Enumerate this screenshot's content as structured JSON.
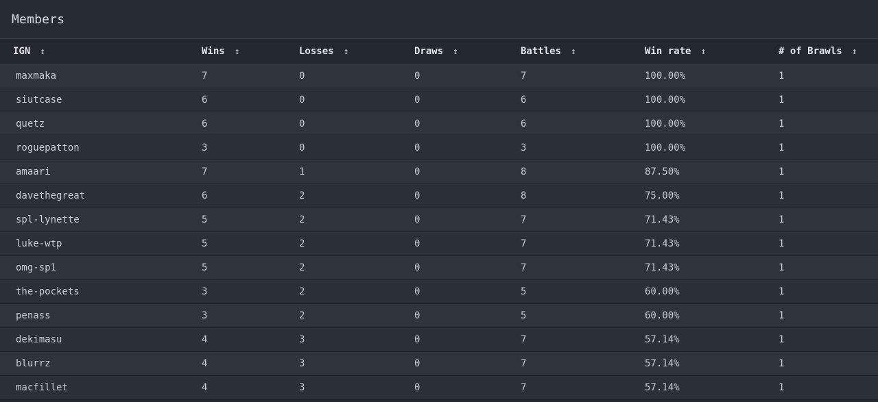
{
  "panel": {
    "title": "Members"
  },
  "table": {
    "columns": [
      {
        "label": "IGN",
        "sort_glyph": "↕"
      },
      {
        "label": "Wins",
        "sort_glyph": "↕"
      },
      {
        "label": "Losses",
        "sort_glyph": "↕"
      },
      {
        "label": "Draws",
        "sort_glyph": "↕"
      },
      {
        "label": "Battles",
        "sort_glyph": "↕"
      },
      {
        "label": "Win rate",
        "sort_glyph": "↕"
      },
      {
        "label": "# of Brawls",
        "sort_glyph": "↕"
      }
    ],
    "rows": [
      [
        "maxmaka",
        "7",
        "0",
        "0",
        "7",
        "100.00%",
        "1"
      ],
      [
        "siutcase",
        "6",
        "0",
        "0",
        "6",
        "100.00%",
        "1"
      ],
      [
        "quetz",
        "6",
        "0",
        "0",
        "6",
        "100.00%",
        "1"
      ],
      [
        "roguepatton",
        "3",
        "0",
        "0",
        "3",
        "100.00%",
        "1"
      ],
      [
        "amaari",
        "7",
        "1",
        "0",
        "8",
        "87.50%",
        "1"
      ],
      [
        "davethegreat",
        "6",
        "2",
        "0",
        "8",
        "75.00%",
        "1"
      ],
      [
        "spl-lynette",
        "5",
        "2",
        "0",
        "7",
        "71.43%",
        "1"
      ],
      [
        "luke-wtp",
        "5",
        "2",
        "0",
        "7",
        "71.43%",
        "1"
      ],
      [
        "omg-sp1",
        "5",
        "2",
        "0",
        "7",
        "71.43%",
        "1"
      ],
      [
        "the-pockets",
        "3",
        "2",
        "0",
        "5",
        "60.00%",
        "1"
      ],
      [
        "penass",
        "3",
        "2",
        "0",
        "5",
        "60.00%",
        "1"
      ],
      [
        "dekimasu",
        "4",
        "3",
        "0",
        "7",
        "57.14%",
        "1"
      ],
      [
        "blurrz",
        "4",
        "3",
        "0",
        "7",
        "57.14%",
        "1"
      ],
      [
        "macfillet",
        "4",
        "3",
        "0",
        "7",
        "57.14%",
        "1"
      ]
    ]
  }
}
